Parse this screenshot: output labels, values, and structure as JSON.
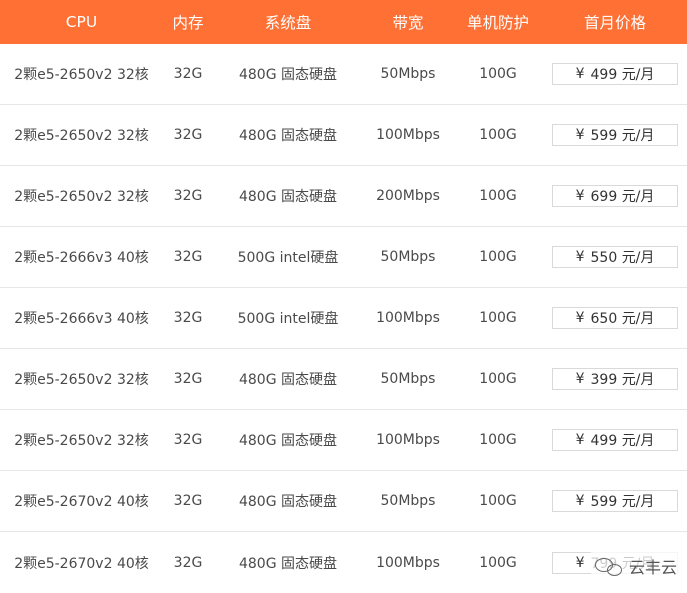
{
  "colors": {
    "header_bg": "#ff7035",
    "header_text": "#ffffff",
    "row_divider": "#e6e6e6"
  },
  "header": {
    "cpu": "CPU",
    "memory": "内存",
    "disk": "系统盘",
    "bandwidth": "带宽",
    "defense": "单机防护",
    "price": "首月价格"
  },
  "rows": [
    {
      "cpu": "2颗e5-2650v2 32核",
      "memory": "32G",
      "disk": "480G 固态硬盘",
      "bandwidth": "50Mbps",
      "defense": "100G",
      "currency": "¥",
      "price": "499 元/月"
    },
    {
      "cpu": "2颗e5-2650v2 32核",
      "memory": "32G",
      "disk": "480G 固态硬盘",
      "bandwidth": "100Mbps",
      "defense": "100G",
      "currency": "¥",
      "price": "599 元/月"
    },
    {
      "cpu": "2颗e5-2650v2 32核",
      "memory": "32G",
      "disk": "480G 固态硬盘",
      "bandwidth": "200Mbps",
      "defense": "100G",
      "currency": "¥",
      "price": "699 元/月"
    },
    {
      "cpu": "2颗e5-2666v3 40核",
      "memory": "32G",
      "disk": "500G intel硬盘",
      "bandwidth": "50Mbps",
      "defense": "100G",
      "currency": "¥",
      "price": "550 元/月"
    },
    {
      "cpu": "2颗e5-2666v3 40核",
      "memory": "32G",
      "disk": "500G intel硬盘",
      "bandwidth": "100Mbps",
      "defense": "100G",
      "currency": "¥",
      "price": "650 元/月"
    },
    {
      "cpu": "2颗e5-2650v2 32核",
      "memory": "32G",
      "disk": "480G 固态硬盘",
      "bandwidth": "50Mbps",
      "defense": "100G",
      "currency": "¥",
      "price": "399 元/月"
    },
    {
      "cpu": "2颗e5-2650v2 32核",
      "memory": "32G",
      "disk": "480G 固态硬盘",
      "bandwidth": "100Mbps",
      "defense": "100G",
      "currency": "¥",
      "price": "499 元/月"
    },
    {
      "cpu": "2颗e5-2670v2 40核",
      "memory": "32G",
      "disk": "480G 固态硬盘",
      "bandwidth": "50Mbps",
      "defense": "100G",
      "currency": "¥",
      "price": "599 元/月"
    },
    {
      "cpu": "2颗e5-2670v2 40核",
      "memory": "32G",
      "disk": "480G 固态硬盘",
      "bandwidth": "100Mbps",
      "defense": "100G",
      "currency": "¥",
      "price": "799 元/月"
    }
  ],
  "watermark": {
    "icon": "wechat-icon",
    "text": "云丰云"
  }
}
